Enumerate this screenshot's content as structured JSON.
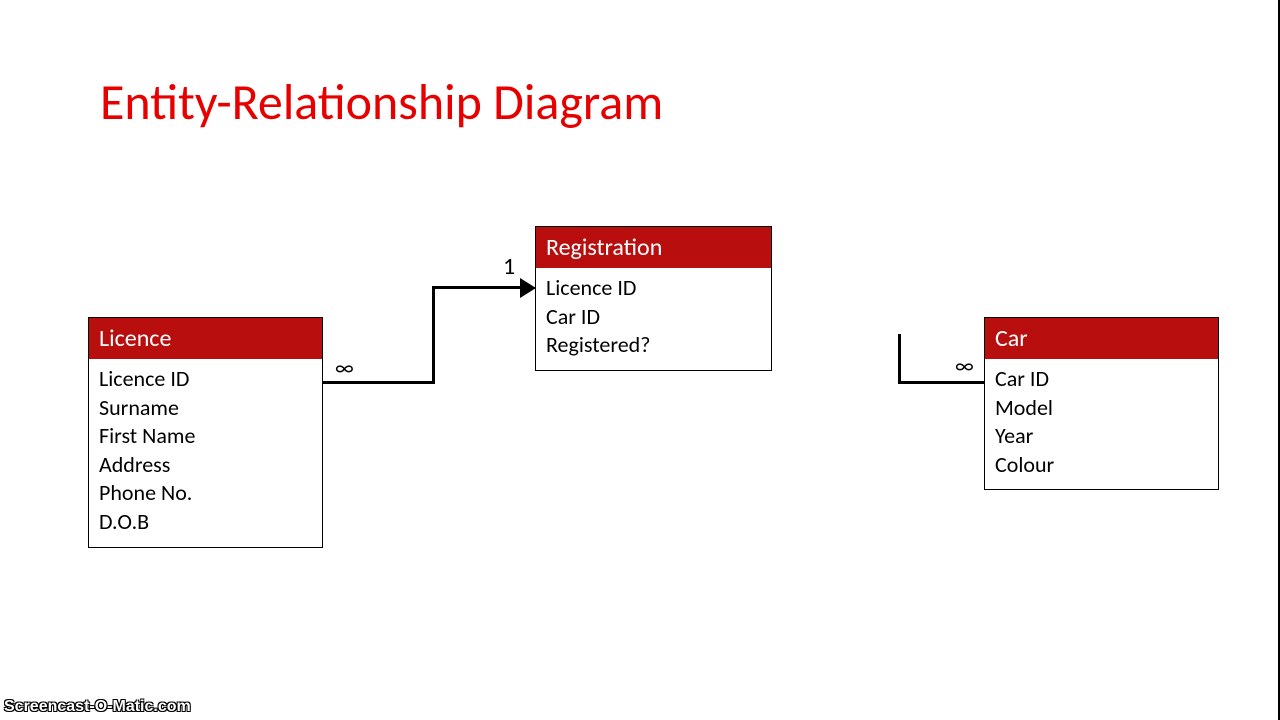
{
  "title": "Entity-Relationship Diagram",
  "entities": {
    "licence": {
      "name": "Licence",
      "attrs": [
        "Licence ID",
        "Surname",
        "First Name",
        "Address",
        "Phone No.",
        "D.O.B"
      ]
    },
    "registration": {
      "name": "Registration",
      "attrs": [
        "Licence ID",
        "Car ID",
        "Registered?"
      ]
    },
    "car": {
      "name": "Car",
      "attrs": [
        "Car ID",
        "Model",
        "Year",
        "Colour"
      ]
    }
  },
  "cardinality": {
    "licence_side": "∞",
    "registration_side": "1",
    "car_side": "∞"
  },
  "watermark": "Screencast-O-Matic.com"
}
